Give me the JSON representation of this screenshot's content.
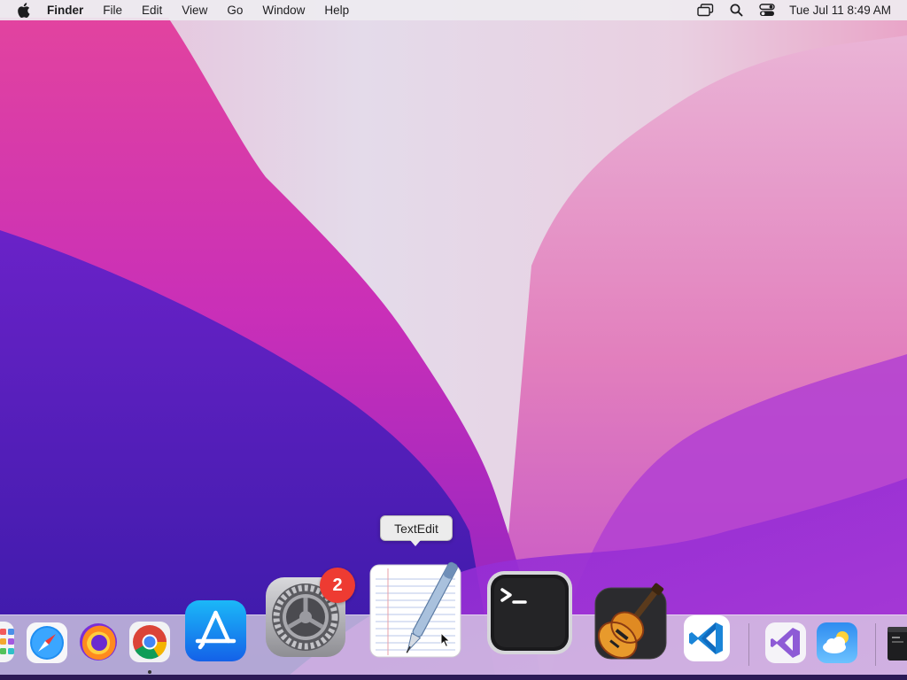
{
  "menubar": {
    "app_name": "Finder",
    "menus": [
      "File",
      "Edit",
      "View",
      "Go",
      "Window",
      "Help"
    ],
    "icons": [
      "apple-logo",
      "screen-mirroring-icon",
      "search-icon",
      "control-center-icon"
    ],
    "clock": "Tue Jul 11  8:49 AM"
  },
  "dock": {
    "tooltip": "TextEdit",
    "apps": [
      {
        "name": "Launchpad",
        "icon": "launchpad-icon"
      },
      {
        "name": "Safari",
        "icon": "safari-icon"
      },
      {
        "name": "Firefox",
        "icon": "firefox-icon"
      },
      {
        "name": "Google Chrome",
        "icon": "chrome-icon",
        "running": true
      },
      {
        "name": "App Store",
        "icon": "app-store-icon"
      },
      {
        "name": "System Preferences",
        "icon": "gear-icon",
        "badge": "2"
      },
      {
        "name": "TextEdit",
        "icon": "textedit-icon"
      },
      {
        "name": "Terminal",
        "icon": "terminal-icon"
      },
      {
        "name": "GarageBand",
        "icon": "guitar-icon"
      },
      {
        "name": "Visual Studio Code",
        "icon": "vscode-icon"
      },
      {
        "name": "Visual Studio",
        "icon": "visual-studio-icon"
      },
      {
        "name": "Weather",
        "icon": "weather-icon"
      },
      {
        "name": "Terminal window",
        "icon": "terminal-window-icon"
      }
    ]
  },
  "colors": {
    "menubar_bg": "#eeecf0",
    "badge_red": "#ee3b32",
    "wallpaper_magenta": "#d83fb4",
    "wallpaper_purple": "#5a1fc8"
  }
}
